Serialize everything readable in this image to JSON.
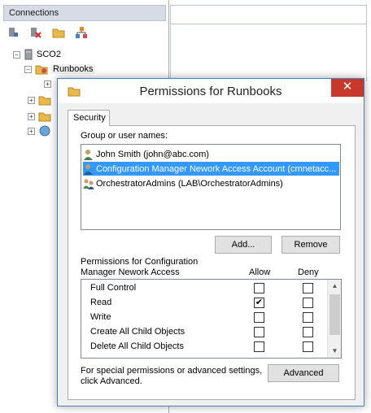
{
  "connections_pane": {
    "header": "Connections",
    "toolbar": [
      {
        "icon": "connect-icon"
      },
      {
        "icon": "disconnect-icon"
      },
      {
        "icon": "folder-icon"
      },
      {
        "icon": "network-icon"
      }
    ],
    "tree": {
      "server": "SCO2",
      "runbooks": "Runbooks"
    }
  },
  "dialog": {
    "title": "Permissions for Runbooks",
    "close_symbol": "✕",
    "tab_label": "Security",
    "group_label": "Group or user names:",
    "users": [
      {
        "name": "John Smith (john@abc.com)",
        "selected": false
      },
      {
        "name": "Configuration Manager Nework Access Account (cmnetacc...",
        "selected": true
      },
      {
        "name": "OrchestratorAdmins (LAB\\OrchestratorAdmins)",
        "selected": false
      }
    ],
    "add_button": "Add...",
    "remove_button": "Remove",
    "permissions_for_line1": "Permissions for Configuration",
    "permissions_for_line2": "Manager Nework Access",
    "allow_header": "Allow",
    "deny_header": "Deny",
    "permissions": [
      {
        "name": "Full Control",
        "allow": false,
        "deny": false
      },
      {
        "name": "Read",
        "allow": true,
        "deny": false
      },
      {
        "name": "Write",
        "allow": false,
        "deny": false
      },
      {
        "name": "Create All Child Objects",
        "allow": false,
        "deny": false
      },
      {
        "name": "Delete All Child Objects",
        "allow": false,
        "deny": false
      }
    ],
    "advanced_text_line1": "For special permissions or advanced settings,",
    "advanced_text_line2": "click Advanced.",
    "advanced_button": "Advanced",
    "check_mark": "✔"
  },
  "colors": {
    "selection": "#3399ff",
    "close_button": "#c7392b",
    "header_bg": "#d6dbe6"
  }
}
